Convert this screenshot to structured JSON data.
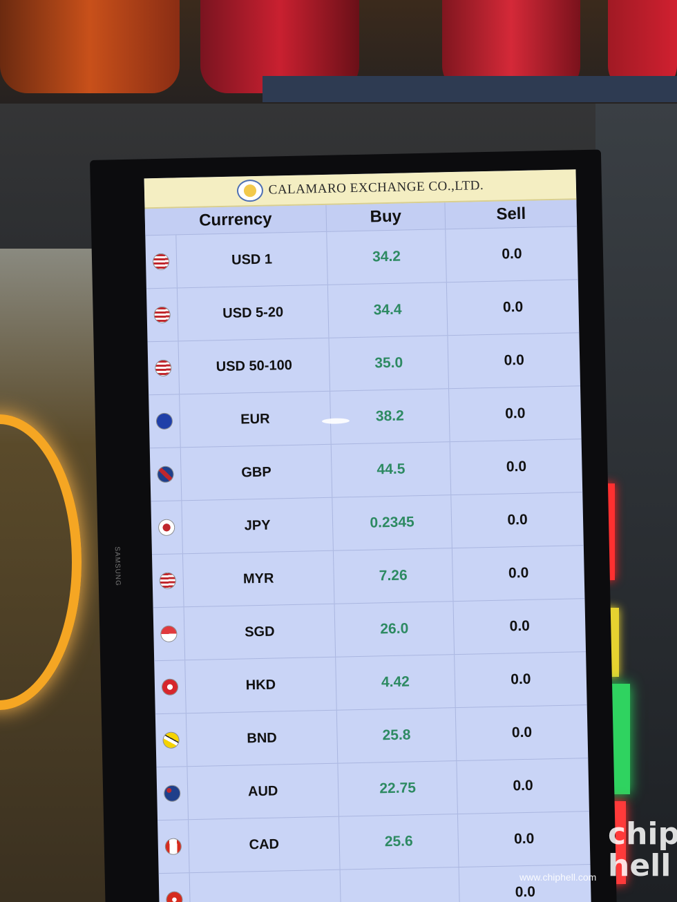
{
  "company": {
    "name": "CALAMARO EXCHANGE CO.,LTD."
  },
  "table": {
    "headers": {
      "currency": "Currency",
      "buy": "Buy",
      "sell": "Sell"
    },
    "rows": [
      {
        "code": "USD 1",
        "buy": "34.2",
        "sell": "0.0",
        "flag_icon": "us-flag-icon"
      },
      {
        "code": "USD 5-20",
        "buy": "34.4",
        "sell": "0.0",
        "flag_icon": "us-flag-icon"
      },
      {
        "code": "USD 50-100",
        "buy": "35.0",
        "sell": "0.0",
        "flag_icon": "us-flag-icon"
      },
      {
        "code": "EUR",
        "buy": "38.2",
        "sell": "0.0",
        "flag_icon": "eu-flag-icon"
      },
      {
        "code": "GBP",
        "buy": "44.5",
        "sell": "0.0",
        "flag_icon": "uk-flag-icon"
      },
      {
        "code": "JPY",
        "buy": "0.2345",
        "sell": "0.0",
        "flag_icon": "jp-flag-icon"
      },
      {
        "code": "MYR",
        "buy": "7.26",
        "sell": "0.0",
        "flag_icon": "my-flag-icon"
      },
      {
        "code": "SGD",
        "buy": "26.0",
        "sell": "0.0",
        "flag_icon": "sg-flag-icon"
      },
      {
        "code": "HKD",
        "buy": "4.42",
        "sell": "0.0",
        "flag_icon": "hk-flag-icon"
      },
      {
        "code": "BND",
        "buy": "25.8",
        "sell": "0.0",
        "flag_icon": "bn-flag-icon"
      },
      {
        "code": "AUD",
        "buy": "22.75",
        "sell": "0.0",
        "flag_icon": "au-flag-icon"
      },
      {
        "code": "CAD",
        "buy": "25.6",
        "sell": "0.0",
        "flag_icon": "ca-flag-icon"
      },
      {
        "code": "",
        "buy": "",
        "sell": "0.0",
        "flag_icon": "ch-flag-icon"
      }
    ]
  },
  "monitor": {
    "brand": "SAMSUNG"
  },
  "watermark": {
    "url": "www.chiphell.com",
    "logo": "chip hell"
  },
  "colors": {
    "buy_text": "#2d8a62",
    "header_bg": "#f4eec2",
    "screen_bg": "#c9d4f6"
  }
}
